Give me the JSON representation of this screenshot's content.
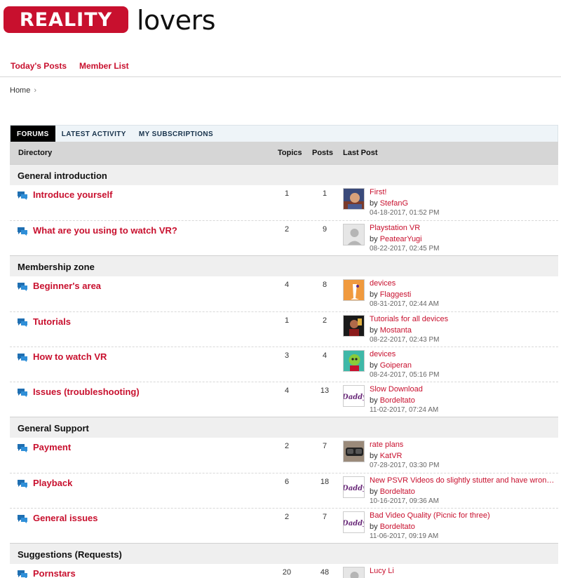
{
  "brand": {
    "word1": "REALITY",
    "word2": "lovers",
    "color": "#c8102e"
  },
  "topnav": [
    {
      "label": "Today's Posts"
    },
    {
      "label": "Member List"
    }
  ],
  "breadcrumb": {
    "home": "Home",
    "sep": "›"
  },
  "tabs": [
    {
      "label": "FORUMS",
      "active": true
    },
    {
      "label": "LATEST ACTIVITY",
      "active": false
    },
    {
      "label": "MY SUBSCRIPTIONS",
      "active": false
    }
  ],
  "columns": {
    "directory": "Directory",
    "topics": "Topics",
    "posts": "Posts",
    "last_post": "Last Post"
  },
  "sections": [
    {
      "title": "General introduction",
      "forums": [
        {
          "title": "Introduce yourself",
          "topics": "1",
          "posts": "1",
          "lp_title": "First!",
          "by": "by",
          "user": "StefanG",
          "date": "04-18-2017, 01:52 PM",
          "avatar": "photo-portrait"
        },
        {
          "title": "What are you using to watch VR?",
          "topics": "2",
          "posts": "9",
          "lp_title": "Playstation VR",
          "by": "by",
          "user": "PeatearYugi",
          "date": "08-22-2017, 02:45 PM",
          "avatar": "default-silhouette"
        }
      ]
    },
    {
      "title": "Membership zone",
      "forums": [
        {
          "title": "Beginner's area",
          "topics": "4",
          "posts": "8",
          "lp_title": "devices",
          "by": "by",
          "user": "Flaggesti",
          "date": "08-31-2017, 02:44 AM",
          "avatar": "orange-cartoon"
        },
        {
          "title": "Tutorials",
          "topics": "1",
          "posts": "2",
          "lp_title": "Tutorials for all devices",
          "by": "by",
          "user": "Mostanta",
          "date": "08-22-2017, 02:43 PM",
          "avatar": "dark-photo"
        },
        {
          "title": "How to watch VR",
          "topics": "3",
          "posts": "4",
          "lp_title": "devices",
          "by": "by",
          "user": "Goiperan",
          "date": "08-24-2017, 05:16 PM",
          "avatar": "teal-cartoon"
        },
        {
          "title": "Issues (troubleshooting)",
          "topics": "4",
          "posts": "13",
          "lp_title": "Slow Download",
          "by": "by",
          "user": "Bordeltato",
          "date": "11-02-2017, 07:24 AM",
          "avatar": "daddy-logo"
        }
      ]
    },
    {
      "title": "General Support",
      "forums": [
        {
          "title": "Payment",
          "topics": "2",
          "posts": "7",
          "lp_title": "rate plans",
          "by": "by",
          "user": "KatVR",
          "date": "07-28-2017, 03:30 PM",
          "avatar": "vr-headset"
        },
        {
          "title": "Playback",
          "topics": "6",
          "posts": "18",
          "lp_title": "New PSVR Videos do slightly stutter and have wrong resolution",
          "by": "by",
          "user": "Bordeltato",
          "date": "10-16-2017, 09:36 AM",
          "avatar": "daddy-logo"
        },
        {
          "title": "General issues",
          "topics": "2",
          "posts": "7",
          "lp_title": "Bad Video Quality (Picnic for three)",
          "by": "by",
          "user": "Bordeltato",
          "date": "11-06-2017, 09:19 AM",
          "avatar": "daddy-logo"
        }
      ]
    },
    {
      "title": "Suggestions (Requests)",
      "forums": [
        {
          "title": "Pornstars",
          "topics": "20",
          "posts": "48",
          "lp_title": "Lucy Li",
          "by": "",
          "user": "",
          "date": "",
          "avatar": "default-silhouette"
        }
      ]
    }
  ]
}
